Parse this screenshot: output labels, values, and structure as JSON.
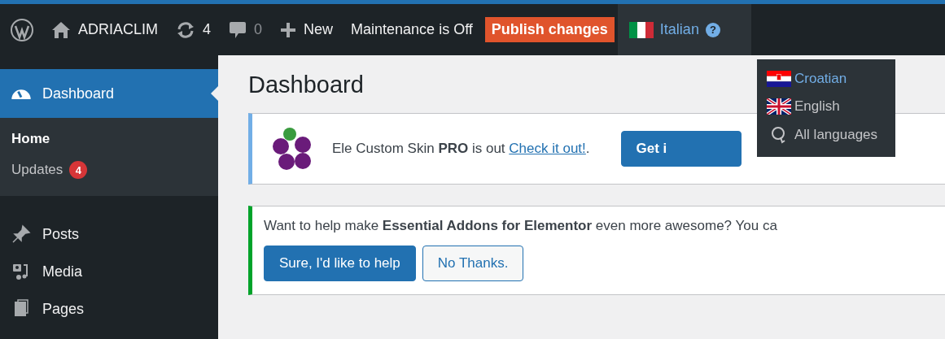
{
  "admin_bar": {
    "site": "ADRIACLIM",
    "updates": "4",
    "comments": "0",
    "new": "New",
    "maintenance": "Maintenance is Off",
    "publish": "Publish changes",
    "language": {
      "label": "Italian",
      "help": "?",
      "open": true,
      "options": [
        {
          "kind": "croatia",
          "label": "Croatian",
          "highlighted": true
        },
        {
          "kind": "uk",
          "label": "English",
          "highlighted": false
        },
        {
          "kind": "all",
          "label": "All languages",
          "highlighted": false
        }
      ]
    }
  },
  "sidebar": {
    "items": [
      {
        "kind": "dashboard",
        "label": "Dashboard",
        "selected": true,
        "children": [
          {
            "label": "Home",
            "selected": true
          },
          {
            "label": "Updates",
            "selected": false,
            "badge": "4"
          }
        ]
      },
      {
        "kind": "posts",
        "label": "Posts",
        "selected": false
      },
      {
        "kind": "media",
        "label": "Media",
        "selected": false
      },
      {
        "kind": "pages",
        "label": "Pages",
        "selected": false
      }
    ]
  },
  "page_title": "Dashboard",
  "notices": [
    {
      "kind": "promo",
      "text": "Ele Custom Skin **PRO** is out",
      "link": "Check it out!",
      "after": ".",
      "button": "Get i"
    },
    {
      "kind": "feedback",
      "text": "Want to help make **Essential Addons for Elementor** even more awesome? You ca",
      "buttons": [
        {
          "label": "Sure, I'd like to help",
          "primary": true
        },
        {
          "label": "No Thanks.",
          "primary": false
        }
      ]
    }
  ]
}
